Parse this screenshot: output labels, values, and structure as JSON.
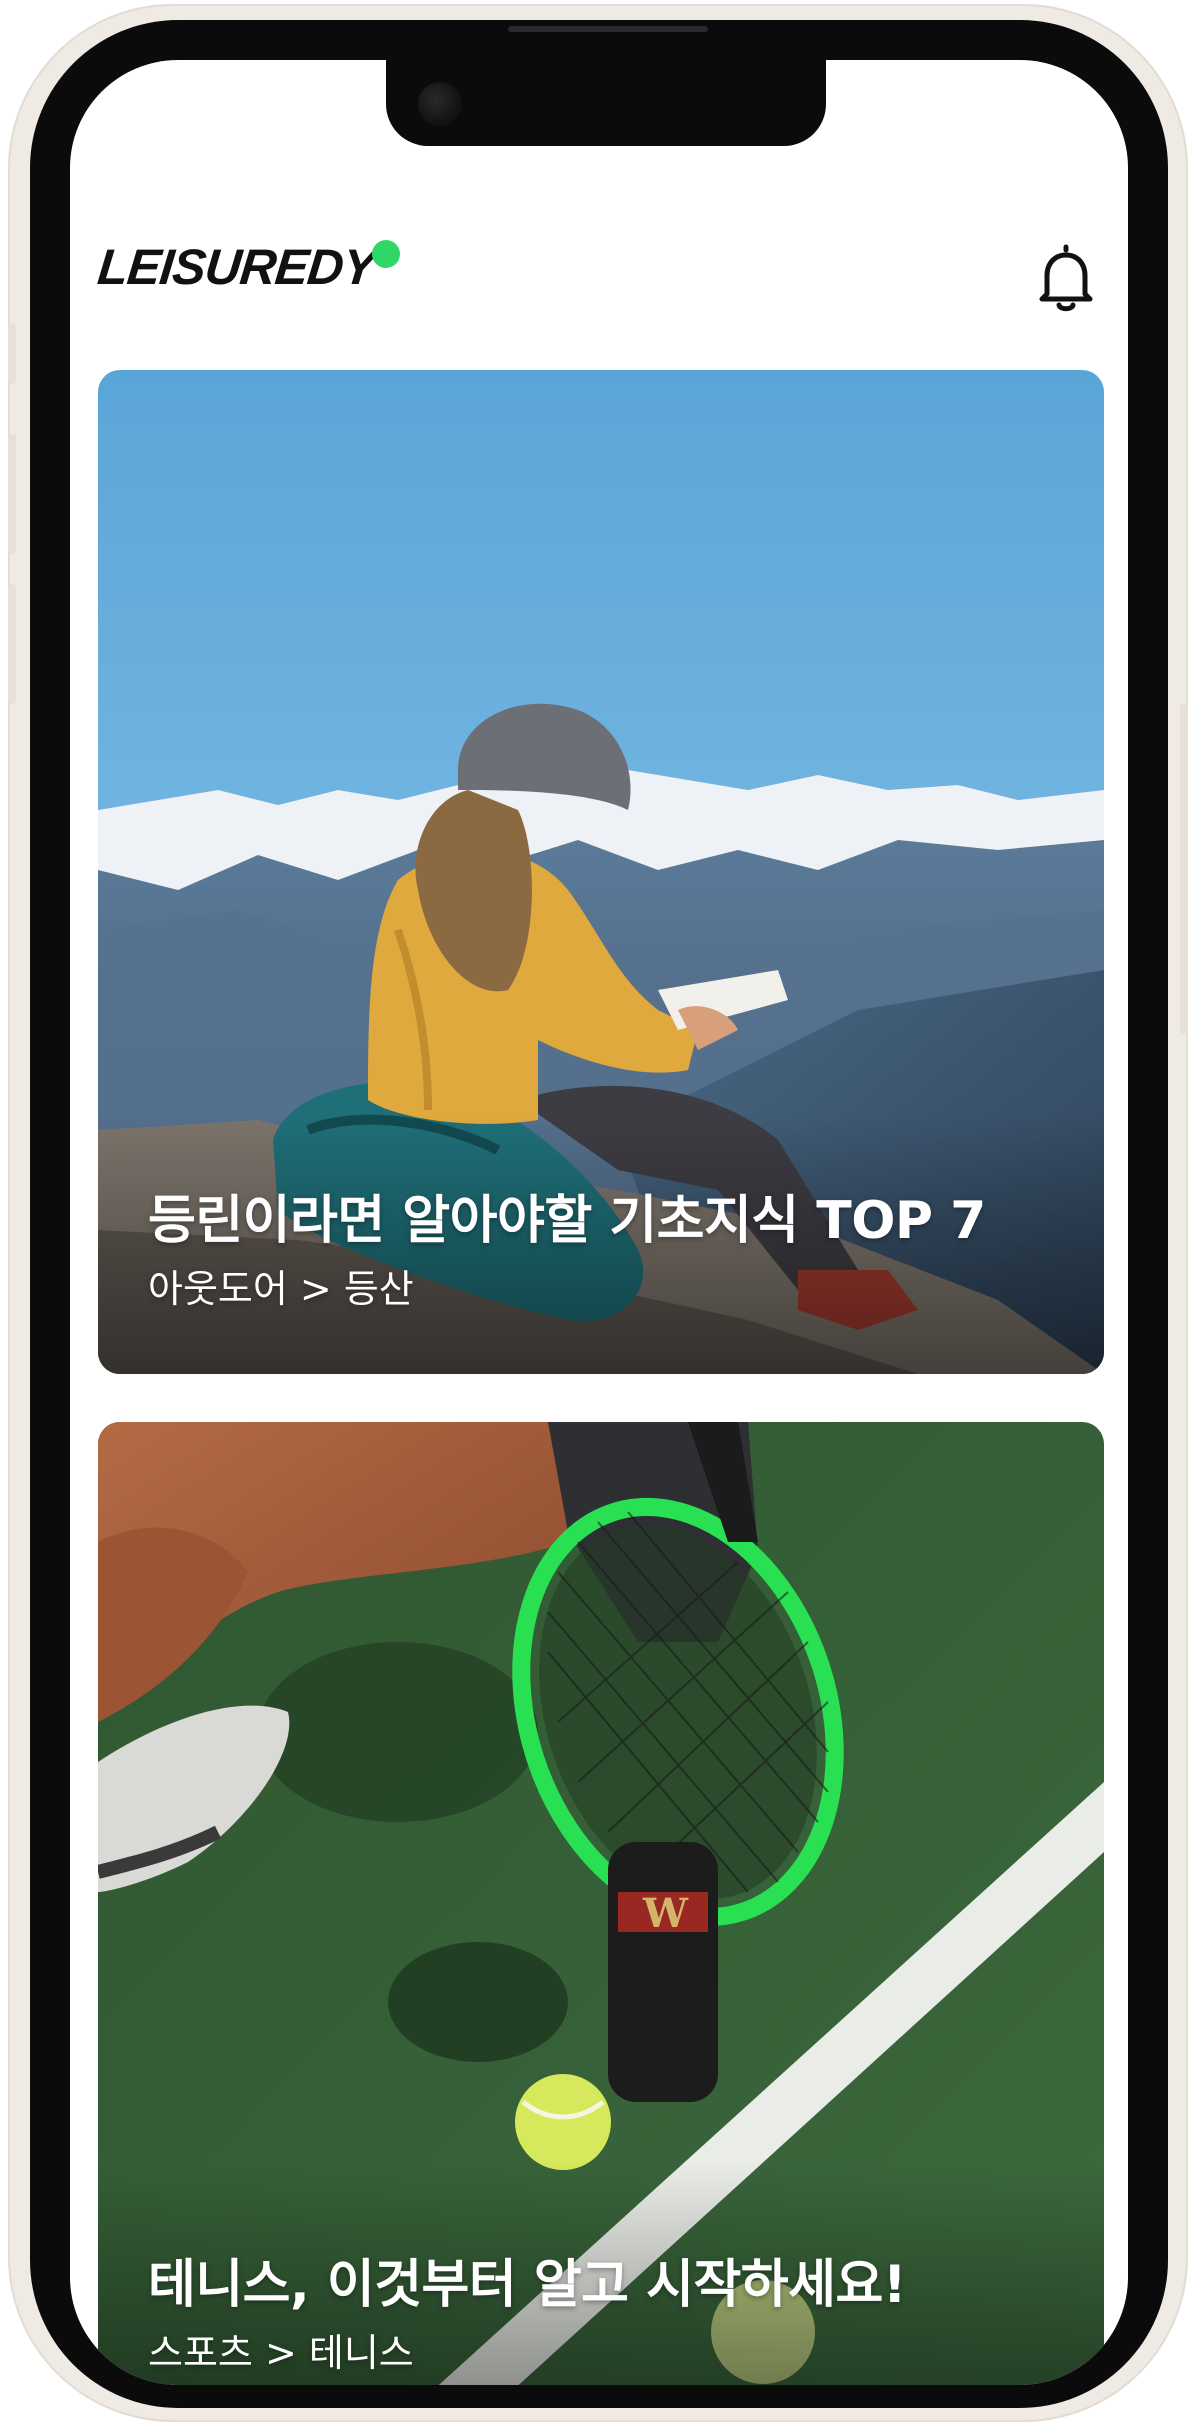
{
  "app": {
    "logo_text": "LEISUREDY",
    "accent_color": "#2fd866"
  },
  "header": {
    "notification_icon": "bell-icon"
  },
  "feed": {
    "cards": [
      {
        "title": "등린이라면 알아야할 기초지식 TOP 7",
        "category": "아웃도어 > 등산",
        "image": "hiker-writing-on-mountain"
      },
      {
        "title": "테니스, 이것부터 알고 시작하세요!",
        "category": "스포츠 > 테니스",
        "image": "tennis-racket-on-court"
      }
    ]
  }
}
